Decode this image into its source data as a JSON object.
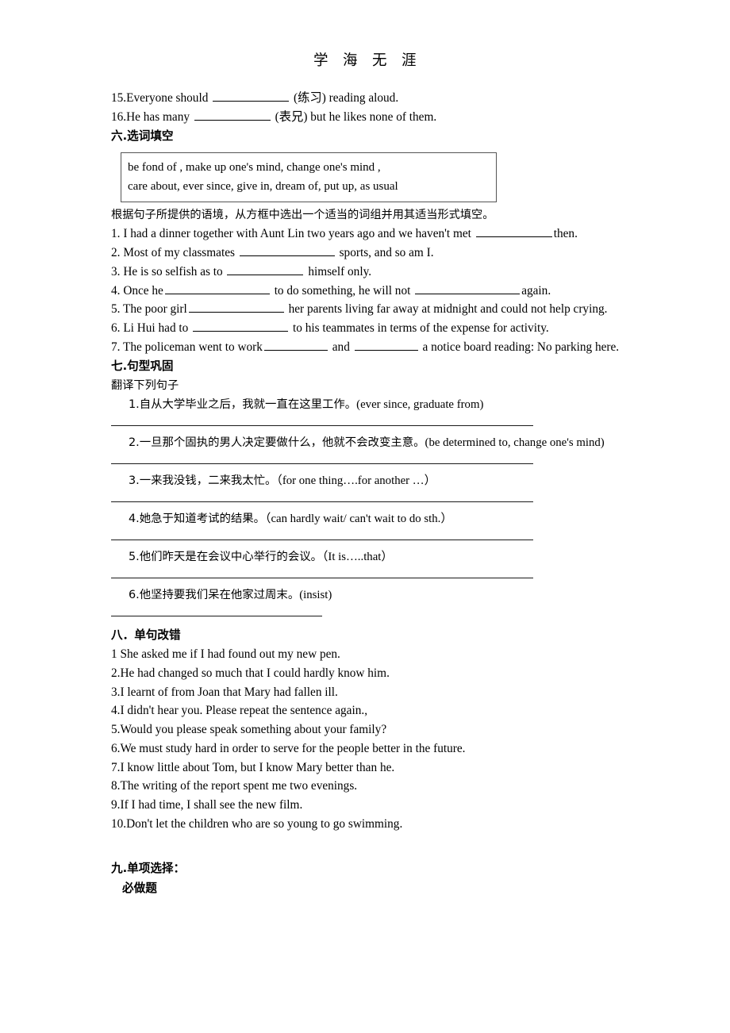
{
  "header": {
    "chars": [
      "学",
      "海",
      "无",
      "涯"
    ]
  },
  "carryover_items": [
    {
      "num": "15.",
      "pre": "Everyone should",
      "hint": "(练习)",
      "post": "reading aloud."
    },
    {
      "num": "16.",
      "pre": "He has many",
      "hint": "(表兄)",
      "post": "but he likes none of them."
    }
  ],
  "section_six": {
    "heading": "六.选词填空",
    "word_box": [
      "be fond of , make up one's mind, change one's mind ,",
      "care about, ever since, give in, dream of, put up, as usual"
    ],
    "instruction": "根据句子所提供的语境，从方框中选出一个适当的词组并用其适当形式填空。",
    "items": [
      {
        "num": "1.",
        "p1": "I had a dinner together with Aunt Lin two years ago and we haven't met",
        "p2": "then.",
        "p3": "",
        "p4": ""
      },
      {
        "num": "2.",
        "p1": "Most of my classmates",
        "p2": "sports, and so am I.",
        "p3": "",
        "p4": ""
      },
      {
        "num": "3.",
        "p1": "He is so selfish as to",
        "p2": "himself only.",
        "p3": "",
        "p4": ""
      },
      {
        "num": "4.",
        "p1": "Once he",
        "p2": "to do something, he will not",
        "p3": "again.",
        "p4": ""
      },
      {
        "num": "5.",
        "p1": "The poor girl",
        "p2": "her parents living far away at midnight and could not help crying.",
        "p3": "",
        "p4": ""
      },
      {
        "num": "6.",
        "p1": "Li Hui had to",
        "p2": "to his teammates in terms of the expense for activity.",
        "p3": "",
        "p4": ""
      },
      {
        "num": "7.",
        "p1": "The policeman went to work",
        "p2": "and",
        "p3": "a notice board reading: No parking here.",
        "p4": ""
      }
    ]
  },
  "section_seven": {
    "heading": "七.句型巩固",
    "instruction": "翻译下列句子",
    "items": [
      {
        "num": "1.",
        "cn": "自从大学毕业之后，我就一直在这里工作。",
        "en": "(ever since, graduate from)"
      },
      {
        "num": "2.",
        "cn": "一旦那个固执的男人决定要做什么，他就不会改变主意。",
        "en": "(be determined to, change one's mind)"
      },
      {
        "num": "3.",
        "cn": "一来我没钱，二来我太忙。",
        "en": "（for one thing….for another …）"
      },
      {
        "num": "4.",
        "cn": "她急于知道考试的结果。",
        "en": "（can hardly wait/ can't wait to do sth.）"
      },
      {
        "num": "5.",
        "cn": "他们昨天是在会议中心举行的会议。",
        "en": "（It is…..that）"
      },
      {
        "num": "6.",
        "cn": "他坚持要我们呆在他家过周末。",
        "en": "(insist)"
      }
    ]
  },
  "section_eight": {
    "heading": "八．单句改错",
    "items": [
      "1 She asked me if I had found out my new pen.",
      "2.He had changed so much that I could hardly know him.",
      "3.I learnt of from Joan that Mary had fallen ill.",
      "4.I didn't hear you. Please repeat the sentence again.,",
      "5.Would you please speak something about your family?",
      "6.We must study hard in order to serve for the people better in the future.",
      "7.I know little about Tom, but I know Mary better than he.",
      "8.The writing of the report spent me two evenings.",
      "9.If I had time, I shall see the new film.",
      "10.Don't let the children who are so young to go swimming."
    ]
  },
  "section_nine": {
    "heading": "九.单项选择：",
    "subheading": "必做题"
  }
}
